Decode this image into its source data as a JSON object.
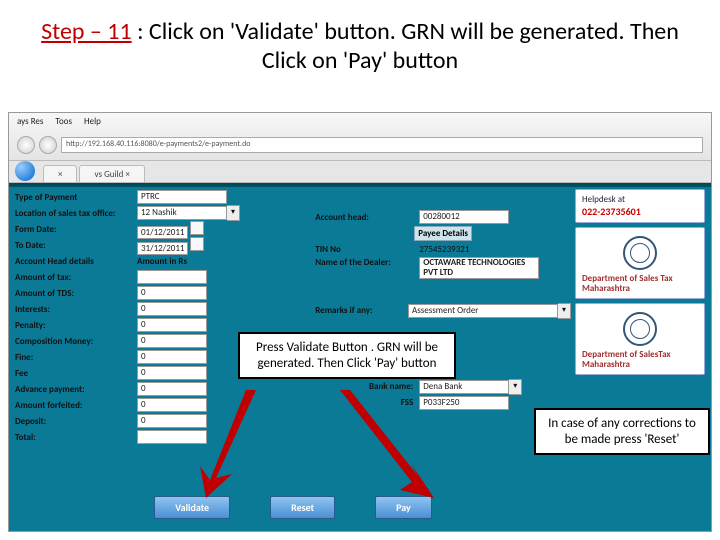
{
  "title": {
    "step": "Step – 11",
    "rest": " : Click on 'Validate' button.  GRN will be generated. Then Click on 'Pay' button"
  },
  "browser": {
    "menu": [
      "ays Res",
      "Toos",
      "Help"
    ],
    "url": "http://192.168.40.116:8080/e-payments2/e-payment.do",
    "tabs": [
      "  ×",
      "vs Guild  ×"
    ]
  },
  "side": {
    "helpdesk_label": "Helpdesk at",
    "helpdesk_num": "022-23735601",
    "dept": "Department of Sales Tax",
    "state": "Maharashtra",
    "dept2": "Department of SalesTax",
    "state2": "Maharashtra"
  },
  "form": {
    "type_of_payment_lbl": "Type of Payment",
    "type_of_payment_val": "PTRC",
    "location_lbl": "Location of sales tax office:",
    "location_val": "12 Nashik",
    "form_date_lbl": "Form Date:",
    "form_date_val": "01/12/2011",
    "to_date_lbl": "To Date:",
    "to_date_val": "31/12/2011",
    "acct_head_det_lbl": "Account Head details",
    "amount_in_rs_lbl": "Amount in Rs",
    "amount_tax_lbl": "Amount of tax:",
    "amount_tds_lbl": "Amount of TDS:",
    "interests_lbl": "Interests:",
    "penalty_lbl": "Penalty:",
    "composition_lbl": "Composition Money:",
    "fine_lbl": "Fine:",
    "fee_lbl": "Fee",
    "advance_lbl": "Advance payment:",
    "forfeited_lbl": "Amount forfeited:",
    "deposit_lbl": "Deposit:",
    "total_lbl": "Total:",
    "account_head_lbl": "Account head:",
    "account_head_val": "00280012",
    "payee_details_hdr": "Payee Details",
    "tin_lbl": "TIN No",
    "tin_val": "27545239321",
    "dealer_lbl": "Name of the Dealer:",
    "dealer_val": "OCTAWARE TECHNOLOGIES PVT LTD",
    "remarks_lbl": "Remarks if any:",
    "remarks_val": "Assessment Order",
    "bank_lbl": "Bank name:",
    "bank_val": "Dena Bank",
    "fss_lbl": "FSS",
    "fss_val": "P033F250",
    "empty": "0"
  },
  "buttons": {
    "validate": "Validate",
    "reset": "Reset",
    "pay": "Pay"
  },
  "callouts": {
    "main": "Press Validate Button . GRN will be generated.  Then Click 'Pay' button",
    "side": "In case of any corrections to be made press 'Reset'"
  }
}
